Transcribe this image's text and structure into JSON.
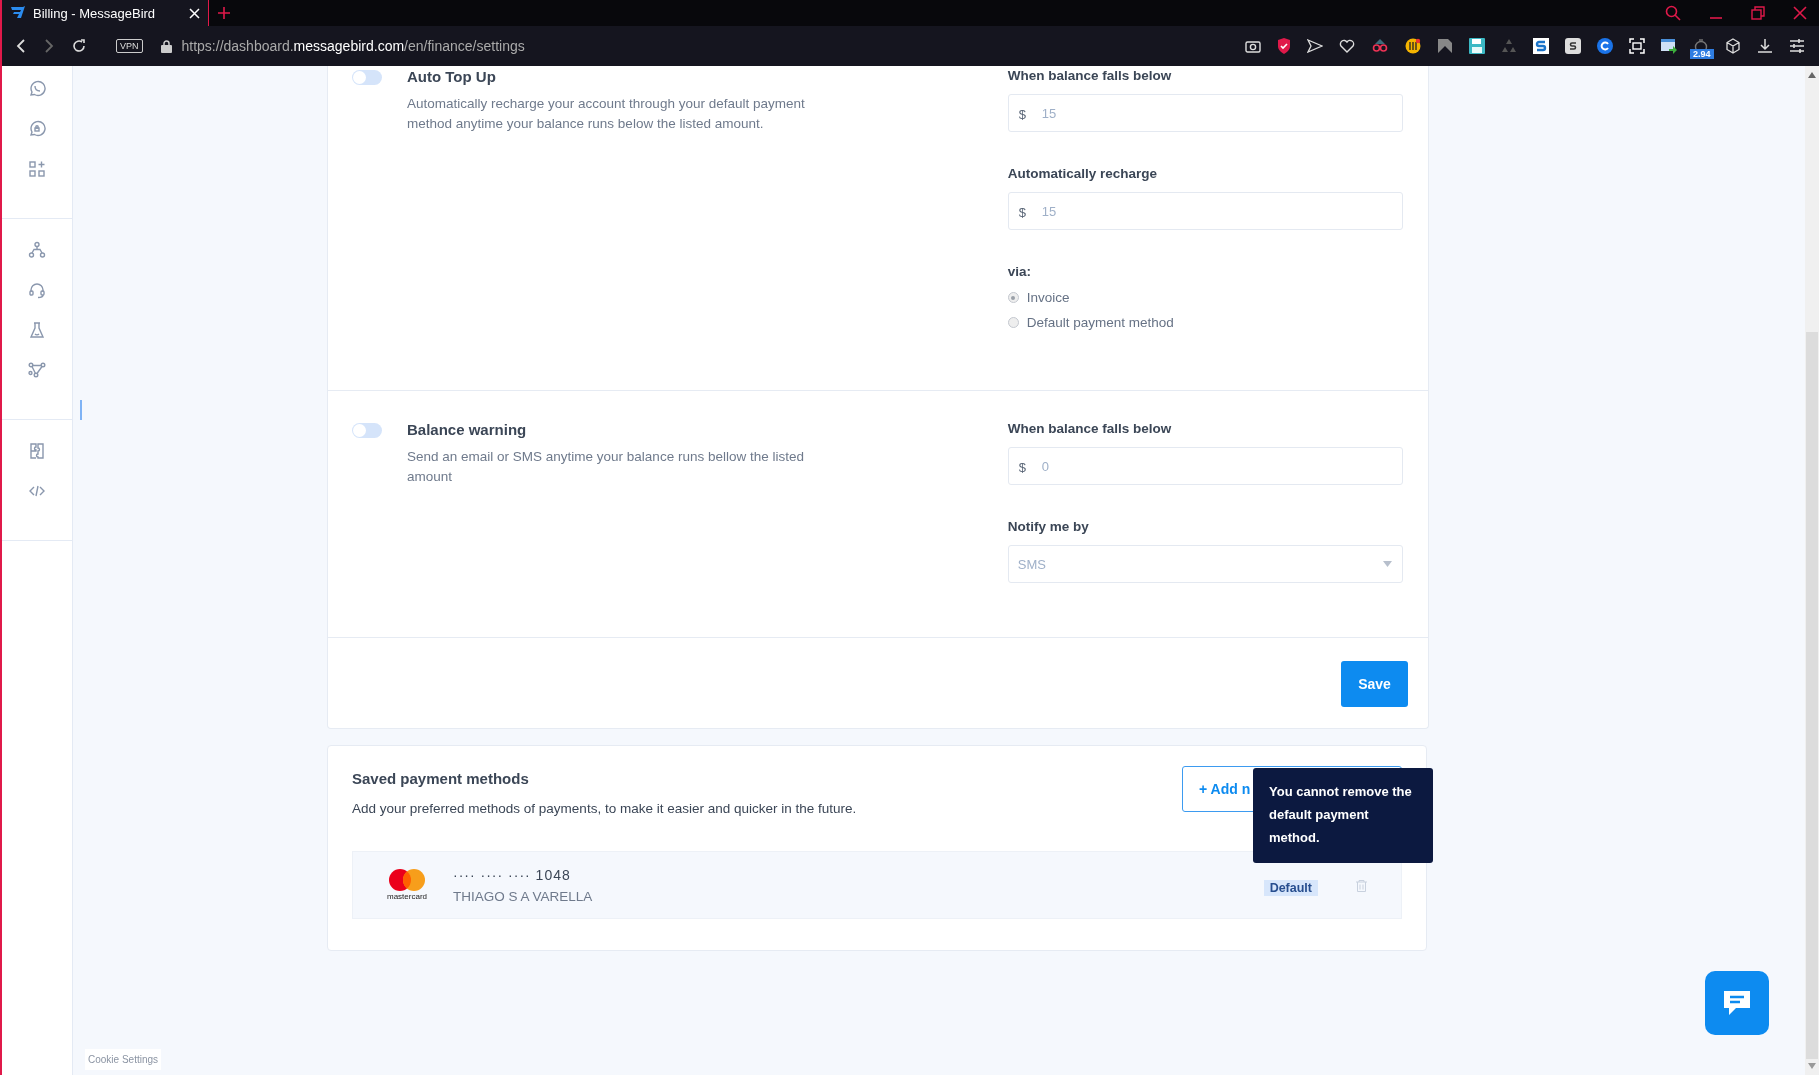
{
  "browser": {
    "tab": {
      "title": "Billing - MessageBird",
      "selected": true
    },
    "url_prefix": "https://dashboard.",
    "url_domain": "messagebird.com",
    "url_path": "/en/finance/settings",
    "vpn": "VPN",
    "extension_badge": "2.94"
  },
  "settings": [
    {
      "title": "Auto Top Up",
      "on": false,
      "description": "Automatically recharge your account through your default payment method anytime your balance runs below the listed amount.",
      "fields": [
        {
          "kind": "amount",
          "label": "When balance falls below",
          "currency": "$",
          "placeholder": "15"
        },
        {
          "kind": "amount",
          "label": "Automatically recharge",
          "currency": "$",
          "placeholder": "15"
        },
        {
          "kind": "radio",
          "label": "via:",
          "options": [
            {
              "label": "Invoice",
              "selected": true
            },
            {
              "label": "Default payment method",
              "selected": false
            }
          ]
        }
      ]
    },
    {
      "title": "Balance warning",
      "on": false,
      "description": "Send an email or SMS anytime your balance runs bellow the listed amount",
      "fields": [
        {
          "kind": "amount",
          "label": "When balance falls below",
          "currency": "$",
          "placeholder": "0"
        },
        {
          "kind": "select",
          "label": "Notify me by",
          "placeholder": "SMS"
        }
      ]
    }
  ],
  "save_button": "Save",
  "payment_methods": {
    "title": "Saved payment methods",
    "description": "Add your preferred methods of payments, to make it easier and quicker in the future.",
    "add_button": "+ Add n",
    "tooltip": "You cannot remove the default payment method.",
    "cards": [
      {
        "brand": "mastercard",
        "mask": "···· ···· ····",
        "last4": "1048",
        "holder": "THIAGO S A VARELLA",
        "badge": "Default"
      }
    ]
  },
  "cookie_settings": "Cookie Settings"
}
